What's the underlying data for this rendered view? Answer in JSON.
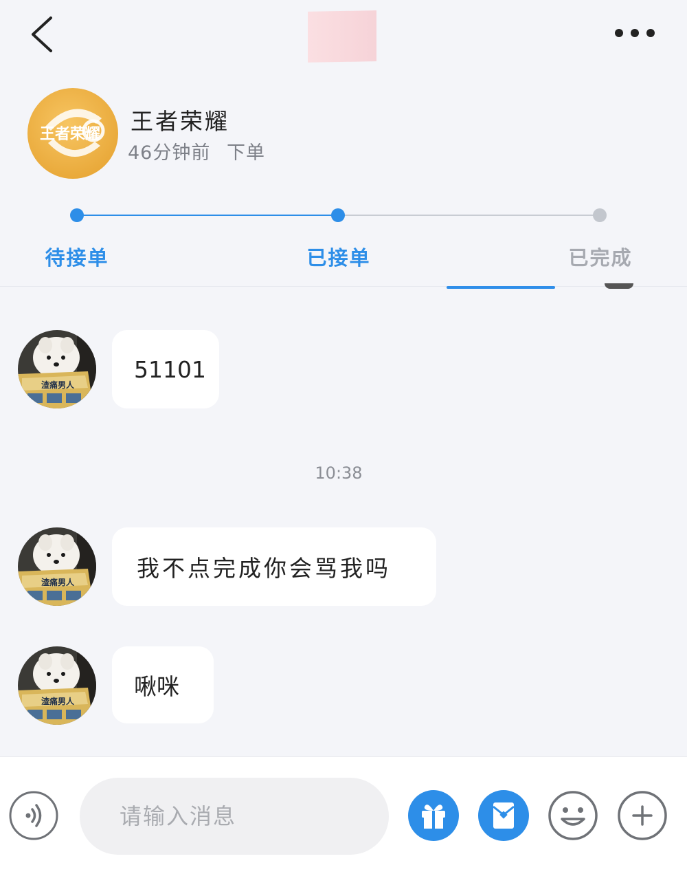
{
  "header": {
    "back_icon": "chevron-left-icon",
    "more_icon": "more-horizontal-icon"
  },
  "order": {
    "game_name": "王者荣耀",
    "game_logo_text": "王者荣耀",
    "time_ago": "46分钟前",
    "status_text": "下单",
    "steps": [
      {
        "label": "待接单",
        "state": "active"
      },
      {
        "label": "已接单",
        "state": "active"
      },
      {
        "label": "已完成",
        "state": "inactive"
      }
    ],
    "accent_color": "#2d8ee8",
    "inactive_color": "#a6a9b0"
  },
  "messages": [
    {
      "text": "51101"
    },
    {
      "text": "我不点完成你会骂我吗"
    },
    {
      "text": "啾咪"
    }
  ],
  "timestamp": "10:38",
  "avatar_caption": "渣痛男人",
  "input": {
    "placeholder": "请输入消息",
    "voice_icon": "voice-icon",
    "gift_icon": "gift-icon",
    "red_packet_icon": "red-packet-icon",
    "emoji_icon": "emoji-icon",
    "add_icon": "plus-circle-icon"
  }
}
